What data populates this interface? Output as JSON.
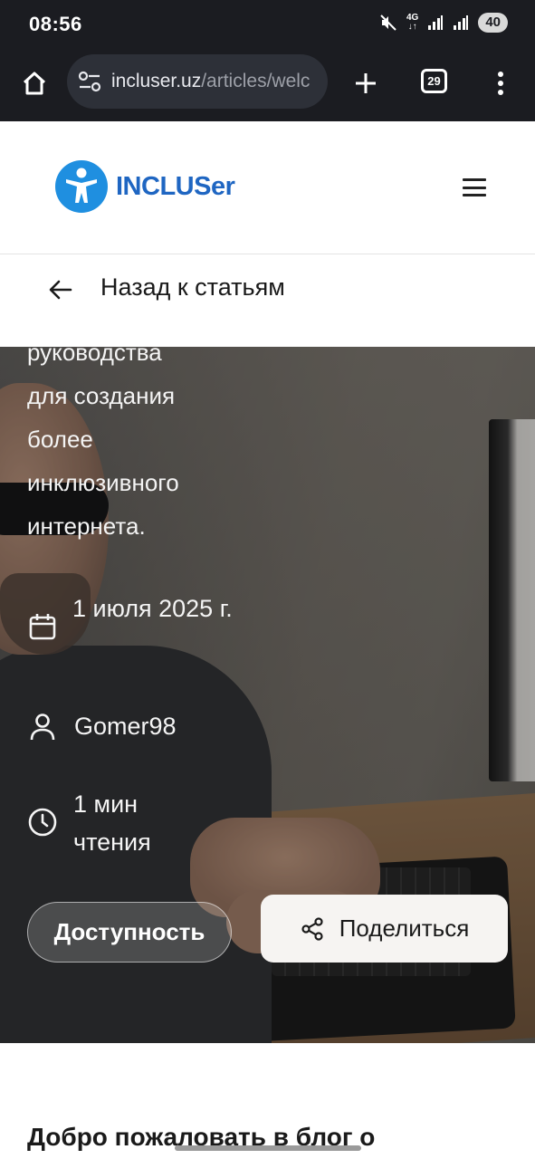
{
  "status_bar": {
    "time": "08:56",
    "network": "4G",
    "battery": "40"
  },
  "browser": {
    "url_host": "incluser.uz",
    "url_path": "/articles/welc",
    "tab_count": "29"
  },
  "site_header": {
    "logo_text": "INCLUSer",
    "menu_icon": "hamburger-icon"
  },
  "back_bar": {
    "label": "Назад к статьям"
  },
  "hero": {
    "description_lines": [
      "руководства",
      "для создания",
      "более",
      "инклюзивного",
      "интернета."
    ],
    "date": "1 июля 2025 г.",
    "author": "Gomer98",
    "read_time": "1 мин чтения",
    "accessibility_button": "Доступность",
    "share_button": "Поделиться"
  },
  "article": {
    "heading": "Добро пожаловать в блог о"
  },
  "colors": {
    "brand_blue": "#1f66c2",
    "browser_bg": "#1b1c21"
  }
}
